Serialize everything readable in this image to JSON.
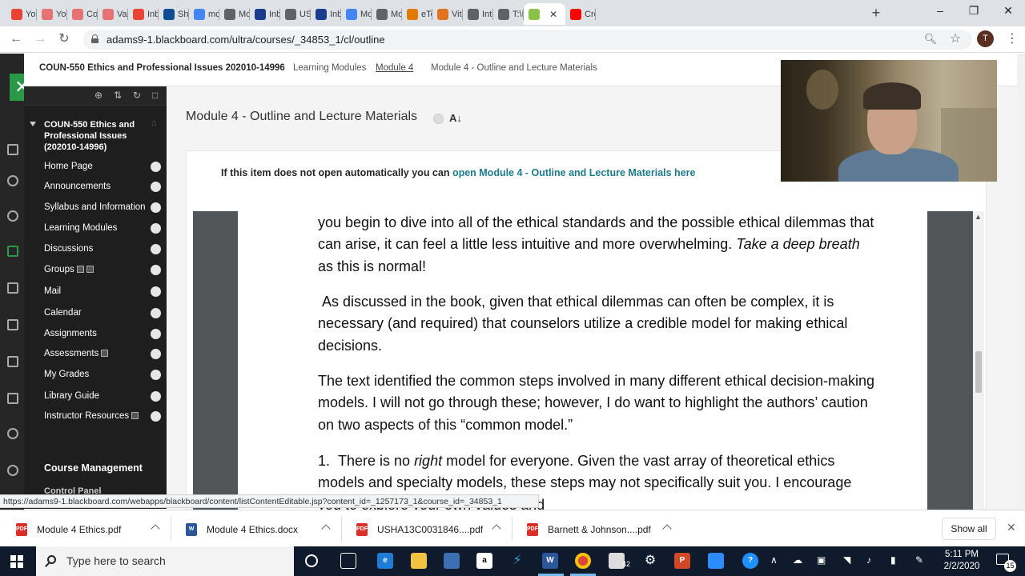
{
  "browser": {
    "tabs": [
      {
        "label": "You",
        "icon": "gmail-icon",
        "color": "#ea4335"
      },
      {
        "label": "You",
        "icon": "ghost-icon",
        "color": "#e57373"
      },
      {
        "label": "Cor",
        "icon": "ghost-icon",
        "color": "#e57373"
      },
      {
        "label": "Vac",
        "icon": "ghost-icon",
        "color": "#e57373"
      },
      {
        "label": "Inb",
        "icon": "gmail-icon",
        "color": "#ea4335"
      },
      {
        "label": "Sho",
        "icon": "a-icon",
        "color": "#0e4d92"
      },
      {
        "label": "mo",
        "icon": "google-icon",
        "color": "#4285f4"
      },
      {
        "label": "Mo",
        "icon": "globe-icon",
        "color": "#5f6368"
      },
      {
        "label": "Inb",
        "icon": "v-icon",
        "color": "#1a3c8c"
      },
      {
        "label": "USH",
        "icon": "globe-icon",
        "color": "#5f6368"
      },
      {
        "label": "Inb",
        "icon": "v-icon",
        "color": "#1a3c8c"
      },
      {
        "label": "Mo",
        "icon": "docs-icon",
        "color": "#4285f4"
      },
      {
        "label": "Mo",
        "icon": "globe-icon",
        "color": "#5f6368"
      },
      {
        "label": "eTe",
        "icon": "v-icon",
        "color": "#e07b00"
      },
      {
        "label": "Vita",
        "icon": "tag-icon",
        "color": "#e0731f"
      },
      {
        "label": "Inte",
        "icon": "globe-icon",
        "color": "#5f6368"
      },
      {
        "label": "T:\\F",
        "icon": "globe-icon",
        "color": "#5f6368"
      },
      {
        "label": "",
        "icon": "pencil-icon",
        "color": "#8bc34a",
        "active": true
      },
      {
        "label": "Cre",
        "icon": "youtube-icon",
        "color": "#ff0000"
      }
    ],
    "url": "adams9-1.blackboard.com/ultra/courses/_34853_1/cl/outline",
    "profile_initial": "T"
  },
  "breadcrumb": {
    "course": "COUN-550 Ethics and Professional Issues 202010-14996",
    "items": [
      "Learning Modules",
      "Module 4",
      "Module 4 - Outline and Lecture Materials"
    ]
  },
  "course_menu": {
    "title": "COUN-550 Ethics and Professional Issues (202010-14996)",
    "items": [
      {
        "label": "Home Page"
      },
      {
        "label": "Announcements"
      },
      {
        "label": "Syllabus and Information"
      },
      {
        "label": "Learning Modules"
      },
      {
        "label": "Discussions"
      },
      {
        "label": "Groups"
      },
      {
        "label": "Mail"
      },
      {
        "label": "Calendar"
      },
      {
        "label": "Assignments"
      },
      {
        "label": "Assessments"
      },
      {
        "label": "My Grades"
      },
      {
        "label": "Library Guide"
      },
      {
        "label": "Instructor Resources"
      }
    ],
    "management": "Course Management",
    "management_next": "Control Panel"
  },
  "content": {
    "title": "Module 4 - Outline and Lecture Materials",
    "notice": "If this item does not open automatically you can ",
    "notice_link": "open Module 4 - Outline and Lecture Materials here"
  },
  "pdf": {
    "para1_a": "you begin to dive into all of the ethical standards and the possible ethical dilemmas that can arise, it can feel a little less intuitive and more overwhelming. ",
    "para1_em": "Take a deep breath",
    "para1_b": " as this is normal!",
    "para2": " As discussed in the book, given that ethical dilemmas can often be complex, it is necessary (and required) that counselors utilize a credible model for making ethical decisions.",
    "para3": "The text identified the common steps involved in many different ethical decision-making models. I will not go through these; however, I do want to highlight the authors’ caution on two aspects of this “common model.”",
    "para4_a": "1.  There is no ",
    "para4_em": "right",
    "para4_b": " model for everyone. Given the vast array of theoretical ethics models and specialty models, these steps may not specifically suit you. I encourage you to explore your own values and"
  },
  "status_url": "https://adams9-1.blackboard.com/webapps/blackboard/content/listContentEditable.jsp?content_id=_1257173_1&course_id=_34853_1",
  "downloads": {
    "files": [
      {
        "name": "Module 4 Ethics.pdf",
        "type": "pdf"
      },
      {
        "name": "Module 4 Ethics.docx",
        "type": "docx"
      },
      {
        "name": "USHA13C0031846....pdf",
        "type": "pdf"
      },
      {
        "name": "Barnett & Johnson....pdf",
        "type": "pdf"
      }
    ],
    "show_all": "Show all"
  },
  "taskbar": {
    "search_placeholder": "Type here to search",
    "mail_badge": "42",
    "time": "5:11 PM",
    "date": "2/2/2020",
    "notification_count": "15"
  }
}
